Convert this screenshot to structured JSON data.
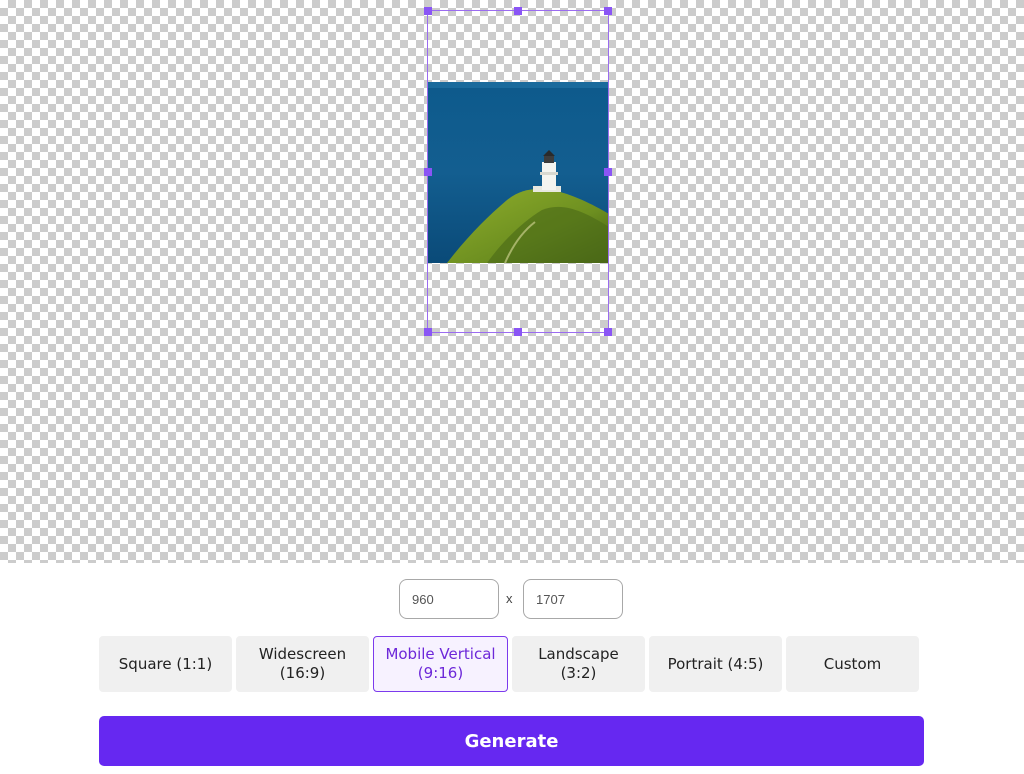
{
  "size": {
    "width_value": "960",
    "height_value": "1707",
    "separator": "x"
  },
  "presets": [
    {
      "label": "Square (1:1)",
      "selected": false
    },
    {
      "label": "Widescreen\n(16:9)",
      "selected": false
    },
    {
      "label": "Mobile Vertical\n(9:16)",
      "selected": true
    },
    {
      "label": "Landscape\n(3:2)",
      "selected": false
    },
    {
      "label": "Portrait (4:5)",
      "selected": false
    },
    {
      "label": "Custom",
      "selected": false
    }
  ],
  "generate_label": "Generate",
  "colors": {
    "accent": "#6628f1",
    "handle": "#8a55f5",
    "selected_text": "#6d28d9"
  }
}
